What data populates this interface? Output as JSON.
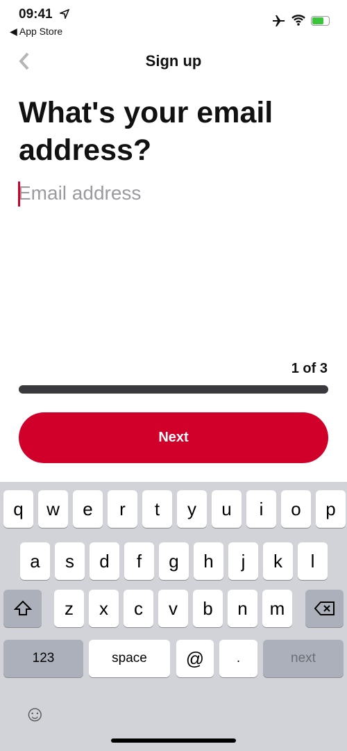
{
  "status_bar": {
    "time": "09:41",
    "back_app": "◀ App Store",
    "icons": [
      "location-arrow-icon",
      "airplane-icon",
      "wifi-icon",
      "battery-charging-icon"
    ]
  },
  "nav": {
    "title": "Sign up",
    "back_icon": "chevron-left-icon"
  },
  "heading": "What's your email address?",
  "email_input": {
    "value": "",
    "placeholder": "Email address"
  },
  "progress": {
    "label": "1 of 3",
    "current": 1,
    "total": 3
  },
  "next_button": "Next",
  "colors": {
    "accent": "#d0002a",
    "progress": "#3a3a3e"
  },
  "keyboard": {
    "row1": [
      "q",
      "w",
      "e",
      "r",
      "t",
      "y",
      "u",
      "i",
      "o",
      "p"
    ],
    "row2": [
      "a",
      "s",
      "d",
      "f",
      "g",
      "h",
      "j",
      "k",
      "l"
    ],
    "row3": [
      "z",
      "x",
      "c",
      "v",
      "b",
      "n",
      "m"
    ],
    "numbers": "123",
    "space": "space",
    "at": "@",
    "dot": ".",
    "next": "next"
  }
}
